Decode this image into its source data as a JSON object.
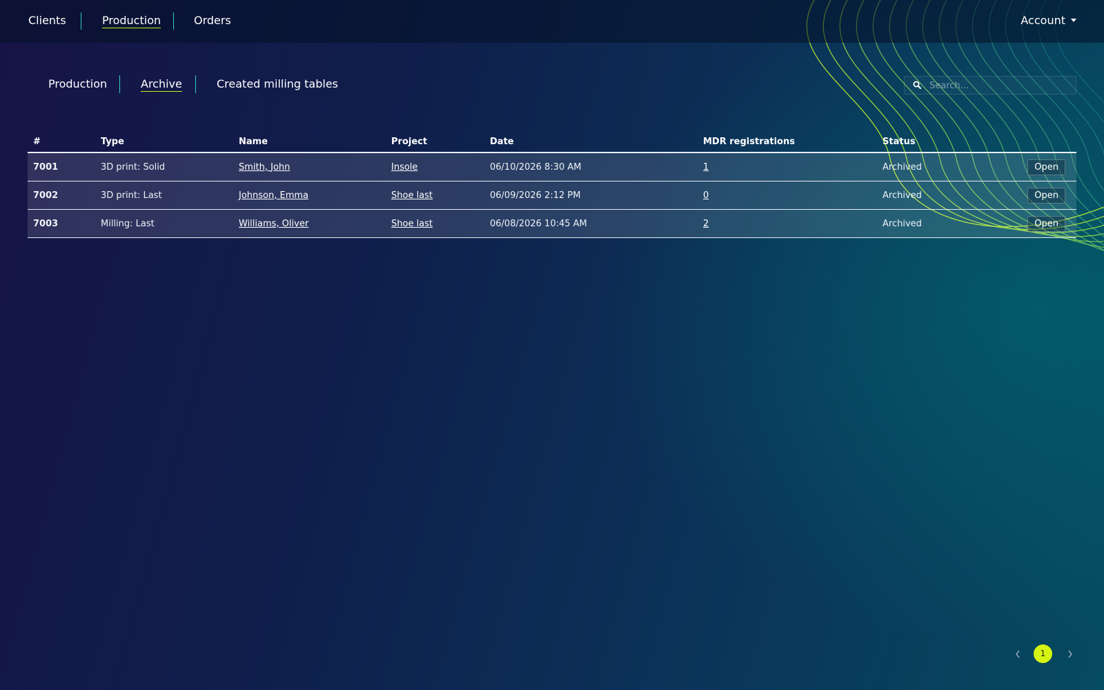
{
  "topnav": {
    "items": [
      {
        "label": "Clients"
      },
      {
        "label": "Production"
      },
      {
        "label": "Orders"
      }
    ],
    "account_label": "Account"
  },
  "subnav": {
    "items": [
      {
        "label": "Production"
      },
      {
        "label": "Archive"
      },
      {
        "label": "Created milling tables"
      }
    ]
  },
  "search": {
    "placeholder": "Search..."
  },
  "table": {
    "columns": [
      "#",
      "Type",
      "Name",
      "Project",
      "Date",
      "MDR registrations",
      "Status"
    ],
    "rows": [
      {
        "id": "7001",
        "type": "3D print: Solid",
        "name": "Smith, John",
        "project": "Insole",
        "date": "06/10/2026 8:30 AM",
        "mdr": "1",
        "status": "Archived",
        "action": "Open"
      },
      {
        "id": "7002",
        "type": "3D print: Last",
        "name": "Johnson, Emma",
        "project": "Shoe last",
        "date": "06/09/2026 2:12 PM",
        "mdr": "0",
        "status": "Archived",
        "action": "Open"
      },
      {
        "id": "7003",
        "type": "Milling: Last",
        "name": "Williams, Oliver",
        "project": "Shoe last",
        "date": "06/08/2026 10:45 AM",
        "mdr": "2",
        "status": "Archived",
        "action": "Open"
      }
    ]
  },
  "pagination": {
    "current_page": "1"
  },
  "colors": {
    "accent": "#d6f414",
    "separator": "#2fd0bd",
    "active_underline": "#c6f21a"
  }
}
